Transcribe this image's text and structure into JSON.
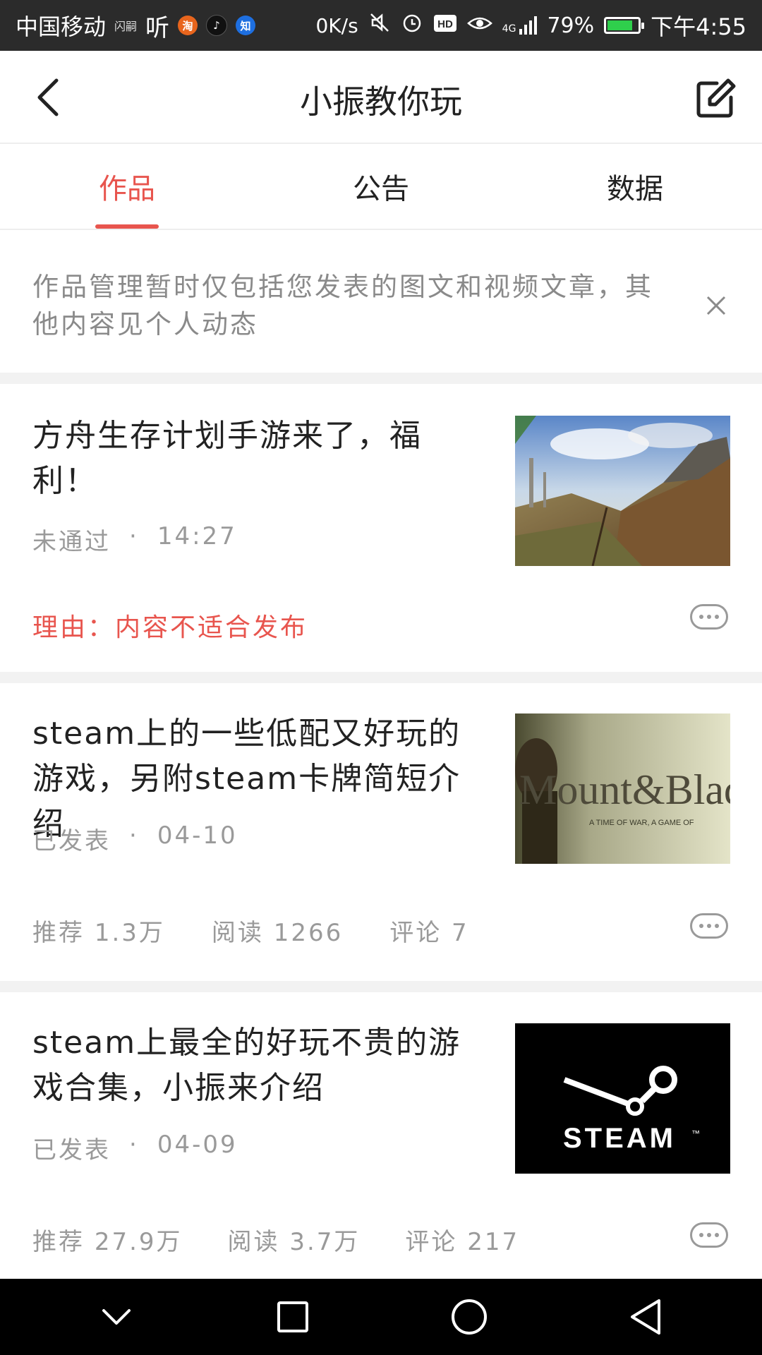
{
  "status_bar": {
    "carrier": "中国移动",
    "carrier_sub": "闪嗣",
    "app_icons": [
      "听",
      "淘",
      "♪",
      "知"
    ],
    "net_speed": "0K/s",
    "signal": "4G",
    "battery_percent": "79%",
    "battery_level": 0.79,
    "time": "下午4:55"
  },
  "header": {
    "title": "小振教你玩"
  },
  "tabs": [
    {
      "label": "作品",
      "active": true
    },
    {
      "label": "公告",
      "active": false
    },
    {
      "label": "数据",
      "active": false
    }
  ],
  "notice": {
    "text": "作品管理暂时仅包括您发表的图文和视频文章，其他内容见个人动态"
  },
  "articles": [
    {
      "title": "方舟生存计划手游来了，福利！",
      "status": "未通过",
      "separator": "·",
      "time": "14:27",
      "reason": "理由：内容不适合发布",
      "thumbnail": "ark-landscape"
    },
    {
      "title": "steam上的一些低配又好玩的游戏，另附steam卡牌简短介绍",
      "status": "已发表",
      "separator": "·",
      "time": "04-10",
      "thumbnail_text": "Mount&Blade",
      "thumbnail_subtext": "A TIME OF WAR, A GAME OF",
      "stats": {
        "recommend_label": "推荐",
        "recommend_value": "1.3万",
        "read_label": "阅读",
        "read_value": "1266",
        "comment_label": "评论",
        "comment_value": "7"
      }
    },
    {
      "title": "steam上最全的好玩不贵的游戏合集，小振来介绍",
      "status": "已发表",
      "separator": "·",
      "time": "04-09",
      "thumbnail_text": "STEAM",
      "thumbnail_tm": "™",
      "stats": {
        "recommend_label": "推荐",
        "recommend_value": "27.9万",
        "read_label": "阅读",
        "read_value": "3.7万",
        "comment_label": "评论",
        "comment_value": "217"
      }
    }
  ],
  "colors": {
    "accent": "#e8554e",
    "muted": "#9a9a9a",
    "status_bar": "#2b2b2b",
    "divider": "#f2f2f2"
  }
}
